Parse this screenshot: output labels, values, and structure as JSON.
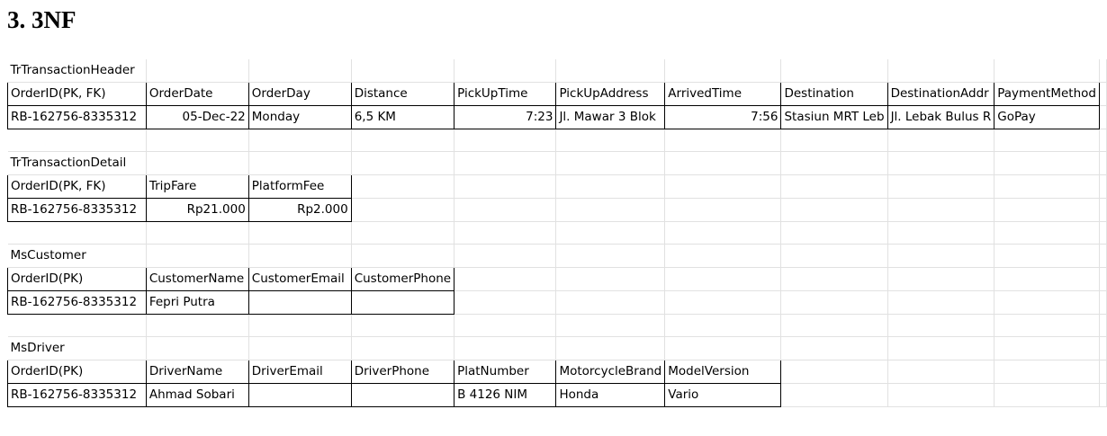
{
  "page_title": "3. 3NF",
  "sheet": {
    "rows": [
      {
        "cells": [
          {
            "text": "TrTransactionHeader"
          },
          {
            "text": ""
          },
          {
            "text": ""
          },
          {
            "text": ""
          },
          {
            "text": ""
          },
          {
            "text": ""
          },
          {
            "text": ""
          },
          {
            "text": ""
          },
          {
            "text": ""
          },
          {
            "text": ""
          },
          {
            "text": ""
          }
        ]
      },
      {
        "cells": [
          {
            "text": "OrderID(PK, FK)",
            "border": true
          },
          {
            "text": "OrderDate",
            "border": true
          },
          {
            "text": "OrderDay",
            "border": true
          },
          {
            "text": "Distance",
            "border": true
          },
          {
            "text": "PickUpTime",
            "border": true
          },
          {
            "text": "PickUpAddress",
            "border": true
          },
          {
            "text": "ArrivedTime",
            "border": true
          },
          {
            "text": "Destination",
            "border": true
          },
          {
            "text": "DestinationAddr",
            "border": true
          },
          {
            "text": "PaymentMethod",
            "border": true
          },
          {
            "text": ""
          }
        ]
      },
      {
        "cells": [
          {
            "text": "RB-162756-8335312",
            "border": true
          },
          {
            "text": "05-Dec-22",
            "border": true,
            "align": "right"
          },
          {
            "text": "Monday",
            "border": true
          },
          {
            "text": "6,5 KM",
            "border": true
          },
          {
            "text": "7:23",
            "border": true,
            "align": "right"
          },
          {
            "text": "Jl. Mawar 3 Blok",
            "border": true
          },
          {
            "text": "7:56",
            "border": true,
            "align": "right"
          },
          {
            "text": "Stasiun MRT Leb",
            "border": true
          },
          {
            "text": "Jl. Lebak Bulus R",
            "border": true
          },
          {
            "text": "GoPay",
            "border": true
          },
          {
            "text": ""
          }
        ]
      },
      {
        "cells": [
          {
            "text": ""
          },
          {
            "text": ""
          },
          {
            "text": ""
          },
          {
            "text": ""
          },
          {
            "text": ""
          },
          {
            "text": ""
          },
          {
            "text": ""
          },
          {
            "text": ""
          },
          {
            "text": ""
          },
          {
            "text": ""
          },
          {
            "text": ""
          }
        ]
      },
      {
        "cells": [
          {
            "text": "TrTransactionDetail"
          },
          {
            "text": ""
          },
          {
            "text": ""
          },
          {
            "text": ""
          },
          {
            "text": ""
          },
          {
            "text": ""
          },
          {
            "text": ""
          },
          {
            "text": ""
          },
          {
            "text": ""
          },
          {
            "text": ""
          },
          {
            "text": ""
          }
        ]
      },
      {
        "cells": [
          {
            "text": "OrderID(PK, FK)",
            "border": true
          },
          {
            "text": "TripFare",
            "border": true
          },
          {
            "text": "PlatformFee",
            "border": true
          },
          {
            "text": ""
          },
          {
            "text": ""
          },
          {
            "text": ""
          },
          {
            "text": ""
          },
          {
            "text": ""
          },
          {
            "text": ""
          },
          {
            "text": ""
          },
          {
            "text": ""
          }
        ]
      },
      {
        "cells": [
          {
            "text": "RB-162756-8335312",
            "border": true
          },
          {
            "text": "Rp21.000",
            "border": true,
            "align": "right"
          },
          {
            "text": "Rp2.000",
            "border": true,
            "align": "right"
          },
          {
            "text": ""
          },
          {
            "text": ""
          },
          {
            "text": ""
          },
          {
            "text": ""
          },
          {
            "text": ""
          },
          {
            "text": ""
          },
          {
            "text": ""
          },
          {
            "text": ""
          }
        ]
      },
      {
        "cells": [
          {
            "text": ""
          },
          {
            "text": ""
          },
          {
            "text": ""
          },
          {
            "text": ""
          },
          {
            "text": ""
          },
          {
            "text": ""
          },
          {
            "text": ""
          },
          {
            "text": ""
          },
          {
            "text": ""
          },
          {
            "text": ""
          },
          {
            "text": ""
          }
        ]
      },
      {
        "cells": [
          {
            "text": "MsCustomer"
          },
          {
            "text": ""
          },
          {
            "text": ""
          },
          {
            "text": ""
          },
          {
            "text": ""
          },
          {
            "text": ""
          },
          {
            "text": ""
          },
          {
            "text": ""
          },
          {
            "text": ""
          },
          {
            "text": ""
          },
          {
            "text": ""
          }
        ]
      },
      {
        "cells": [
          {
            "text": "OrderID(PK)",
            "border": true
          },
          {
            "text": "CustomerName",
            "border": true
          },
          {
            "text": "CustomerEmail",
            "border": true
          },
          {
            "text": "CustomerPhone",
            "border": true
          },
          {
            "text": ""
          },
          {
            "text": ""
          },
          {
            "text": ""
          },
          {
            "text": ""
          },
          {
            "text": ""
          },
          {
            "text": ""
          },
          {
            "text": ""
          }
        ]
      },
      {
        "cells": [
          {
            "text": "RB-162756-8335312",
            "border": true
          },
          {
            "text": "Fepri Putra",
            "border": true
          },
          {
            "text": "",
            "border": true
          },
          {
            "text": "",
            "border": true
          },
          {
            "text": ""
          },
          {
            "text": ""
          },
          {
            "text": ""
          },
          {
            "text": ""
          },
          {
            "text": ""
          },
          {
            "text": ""
          },
          {
            "text": ""
          }
        ]
      },
      {
        "cells": [
          {
            "text": ""
          },
          {
            "text": ""
          },
          {
            "text": ""
          },
          {
            "text": ""
          },
          {
            "text": ""
          },
          {
            "text": ""
          },
          {
            "text": ""
          },
          {
            "text": ""
          },
          {
            "text": ""
          },
          {
            "text": ""
          },
          {
            "text": ""
          }
        ]
      },
      {
        "cells": [
          {
            "text": "MsDriver"
          },
          {
            "text": ""
          },
          {
            "text": ""
          },
          {
            "text": ""
          },
          {
            "text": ""
          },
          {
            "text": ""
          },
          {
            "text": ""
          },
          {
            "text": ""
          },
          {
            "text": ""
          },
          {
            "text": ""
          },
          {
            "text": ""
          }
        ]
      },
      {
        "cells": [
          {
            "text": "OrderID(PK)",
            "border": true
          },
          {
            "text": "DriverName",
            "border": true
          },
          {
            "text": "DriverEmail",
            "border": true
          },
          {
            "text": "DriverPhone",
            "border": true
          },
          {
            "text": "PlatNumber",
            "border": true
          },
          {
            "text": "MotorcycleBrand",
            "border": true
          },
          {
            "text": "ModelVersion",
            "border": true
          },
          {
            "text": ""
          },
          {
            "text": ""
          },
          {
            "text": ""
          },
          {
            "text": ""
          }
        ]
      },
      {
        "cells": [
          {
            "text": "RB-162756-8335312",
            "border": true
          },
          {
            "text": "Ahmad Sobari",
            "border": true
          },
          {
            "text": "",
            "border": true
          },
          {
            "text": "",
            "border": true
          },
          {
            "text": "B 4126 NIM",
            "border": true
          },
          {
            "text": "Honda",
            "border": true
          },
          {
            "text": "Vario",
            "border": true
          },
          {
            "text": ""
          },
          {
            "text": ""
          },
          {
            "text": ""
          },
          {
            "text": ""
          }
        ]
      }
    ]
  }
}
